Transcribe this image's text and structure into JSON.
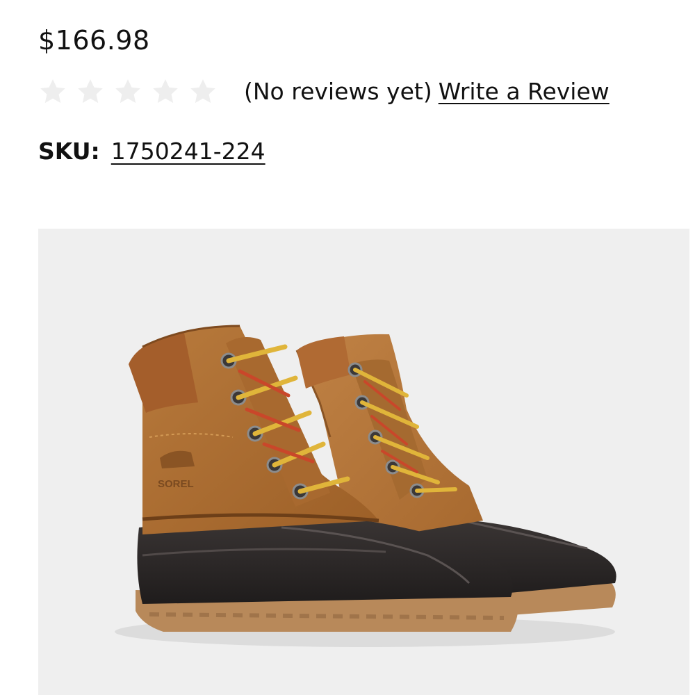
{
  "product": {
    "price": "$166.98",
    "rating": {
      "value": 0,
      "max": 5,
      "summary": "(No reviews yet)",
      "write_review_label": "Write a Review"
    },
    "sku": {
      "label": "SKU:",
      "value": "1750241-224"
    },
    "image": {
      "subject": "pair of boots",
      "background_color": "#efefef",
      "brand_mark": "SOREL"
    }
  },
  "colors": {
    "text": "#111111",
    "star_empty": "#eeeeee"
  }
}
